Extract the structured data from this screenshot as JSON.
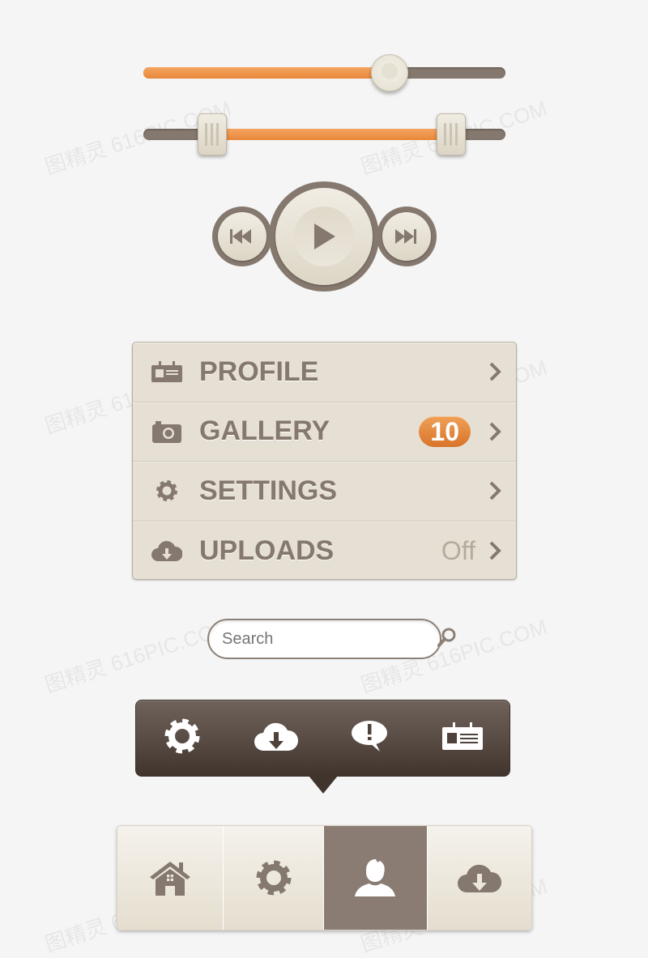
{
  "watermark": "图精灵 616PIC.COM",
  "colors": {
    "accent": "#ea8c3e",
    "dark": "#85786e",
    "panel": "#e6e0d4",
    "toolbar": "#4e423b"
  },
  "slider": {
    "value": 0.68
  },
  "range_slider": {
    "low": 0.19,
    "high": 0.85
  },
  "media": {
    "prev_icon": "rewind-icon",
    "play_icon": "play-icon",
    "next_icon": "fast-forward-icon"
  },
  "menu": {
    "items": [
      {
        "icon": "id-card-icon",
        "label": "PROFILE"
      },
      {
        "icon": "camera-icon",
        "label": "GALLERY",
        "badge": "10"
      },
      {
        "icon": "gear-icon",
        "label": "SETTINGS"
      },
      {
        "icon": "cloud-download-icon",
        "label": "UPLOADS",
        "value": "Off"
      }
    ]
  },
  "search": {
    "placeholder": "Search",
    "icon": "search-icon"
  },
  "toolbar": {
    "icons": [
      "gear-icon",
      "cloud-download-icon",
      "alert-bubble-icon",
      "id-card-icon"
    ]
  },
  "tabbar": {
    "icons": [
      "home-icon",
      "gear-icon",
      "user-icon",
      "cloud-download-icon"
    ],
    "active": 2
  }
}
